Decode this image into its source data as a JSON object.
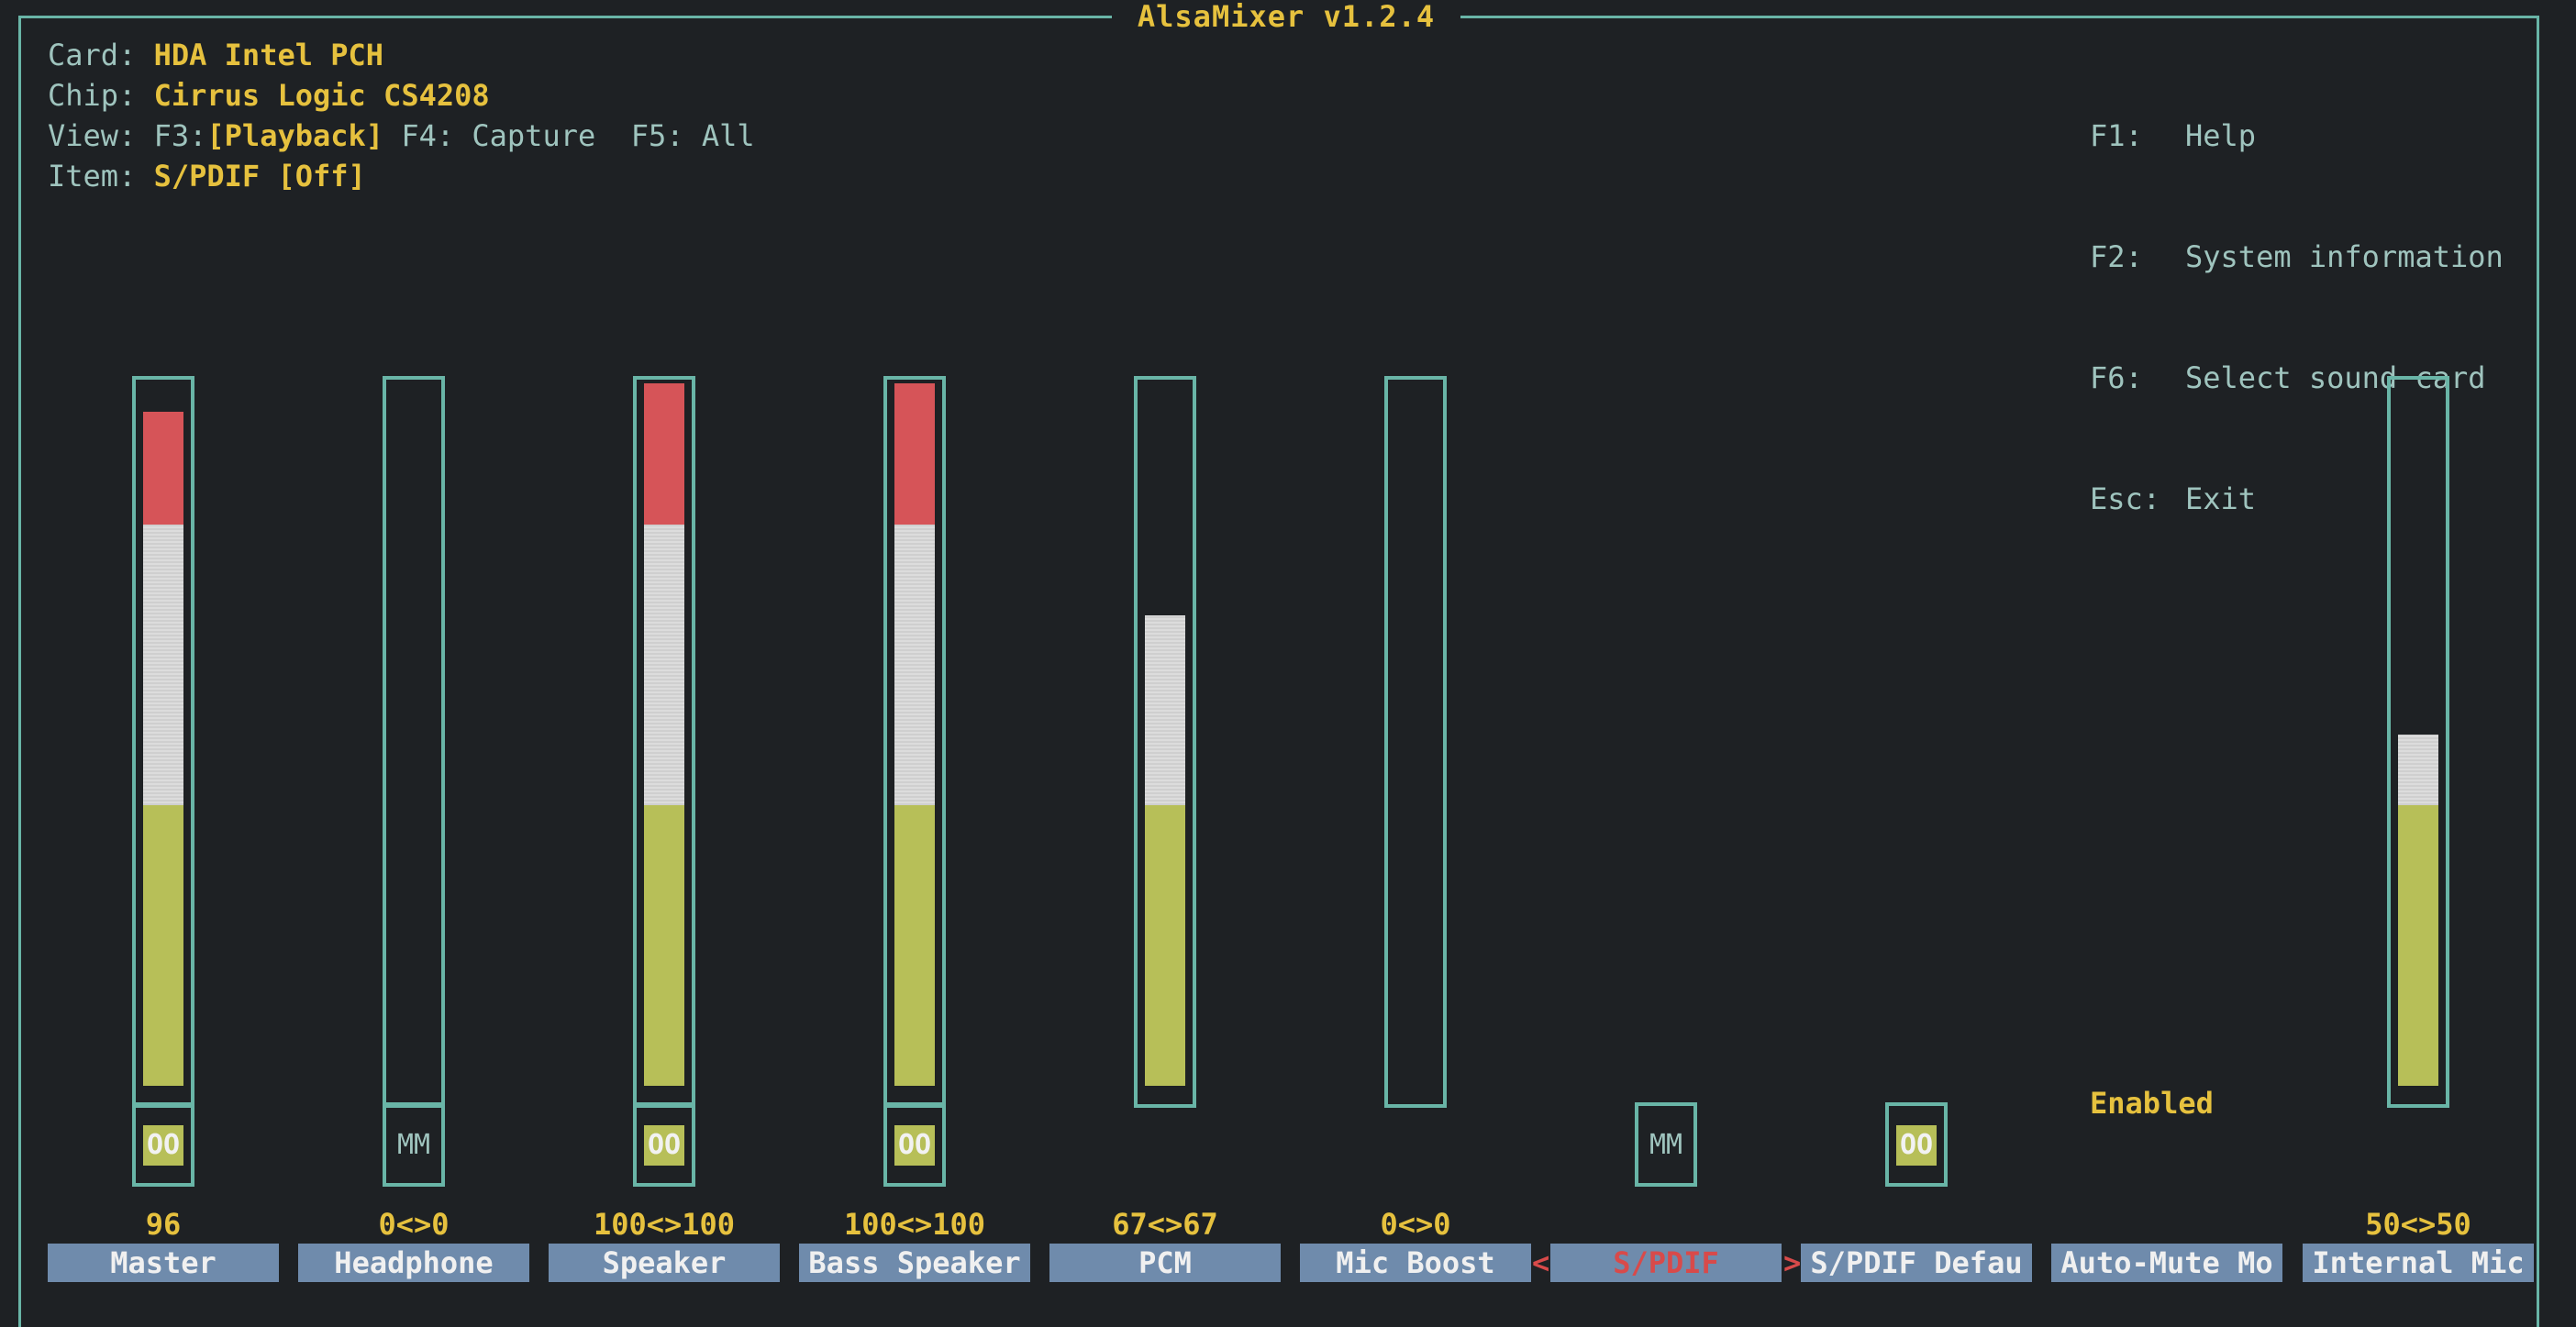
{
  "app": {
    "title": "AlsaMixer v1.2.4"
  },
  "info": {
    "card_label": "Card:",
    "card_value": "HDA Intel PCH",
    "chip_label": "Chip:",
    "chip_value": "Cirrus Logic CS4208",
    "view_label": "View:",
    "view_f3": "F3:",
    "view_playback": "[Playback]",
    "view_rest": " F4: Capture  F5: All",
    "item_label": "Item:",
    "item_value": "S/PDIF [Off]"
  },
  "help": [
    {
      "key": "F1:",
      "text": "Help"
    },
    {
      "key": "F2:",
      "text": "System information"
    },
    {
      "key": "F6:",
      "text": "Select sound card"
    },
    {
      "key": "Esc:",
      "text": "Exit"
    }
  ],
  "controls": [
    {
      "name": "Master",
      "volume": "96",
      "level_pct": 96,
      "switch": "OO"
    },
    {
      "name": "Headphone",
      "volume": "0<>0",
      "level_pct": 0,
      "switch": "MM"
    },
    {
      "name": "Speaker",
      "volume": "100<>100",
      "level_pct": 100,
      "switch": "OO"
    },
    {
      "name": "Bass Speaker",
      "volume": "100<>100",
      "level_pct": 100,
      "switch": "OO"
    },
    {
      "name": "PCM",
      "volume": "67<>67",
      "level_pct": 67,
      "switch": ""
    },
    {
      "name": "Mic Boost",
      "volume": "0<>0",
      "level_pct": 0,
      "switch": ""
    },
    {
      "name": "S/PDIF",
      "volume": "",
      "switch": "MM",
      "selected": true
    },
    {
      "name": "S/PDIF Defau",
      "volume": "",
      "switch": "OO"
    },
    {
      "name": "Auto-Mute Mo",
      "volume": "",
      "enum_value": "Enabled"
    },
    {
      "name": "Internal Mic",
      "volume": "50<>50",
      "level_pct": 50,
      "switch": ""
    }
  ],
  "selection_markers": {
    "left": "<",
    "right": ">"
  },
  "colors": {
    "accent": "#e6c13e",
    "border": "#69b5a7",
    "green": "#b7bf58",
    "red": "#d65458",
    "label_bg": "#6f8bac"
  }
}
